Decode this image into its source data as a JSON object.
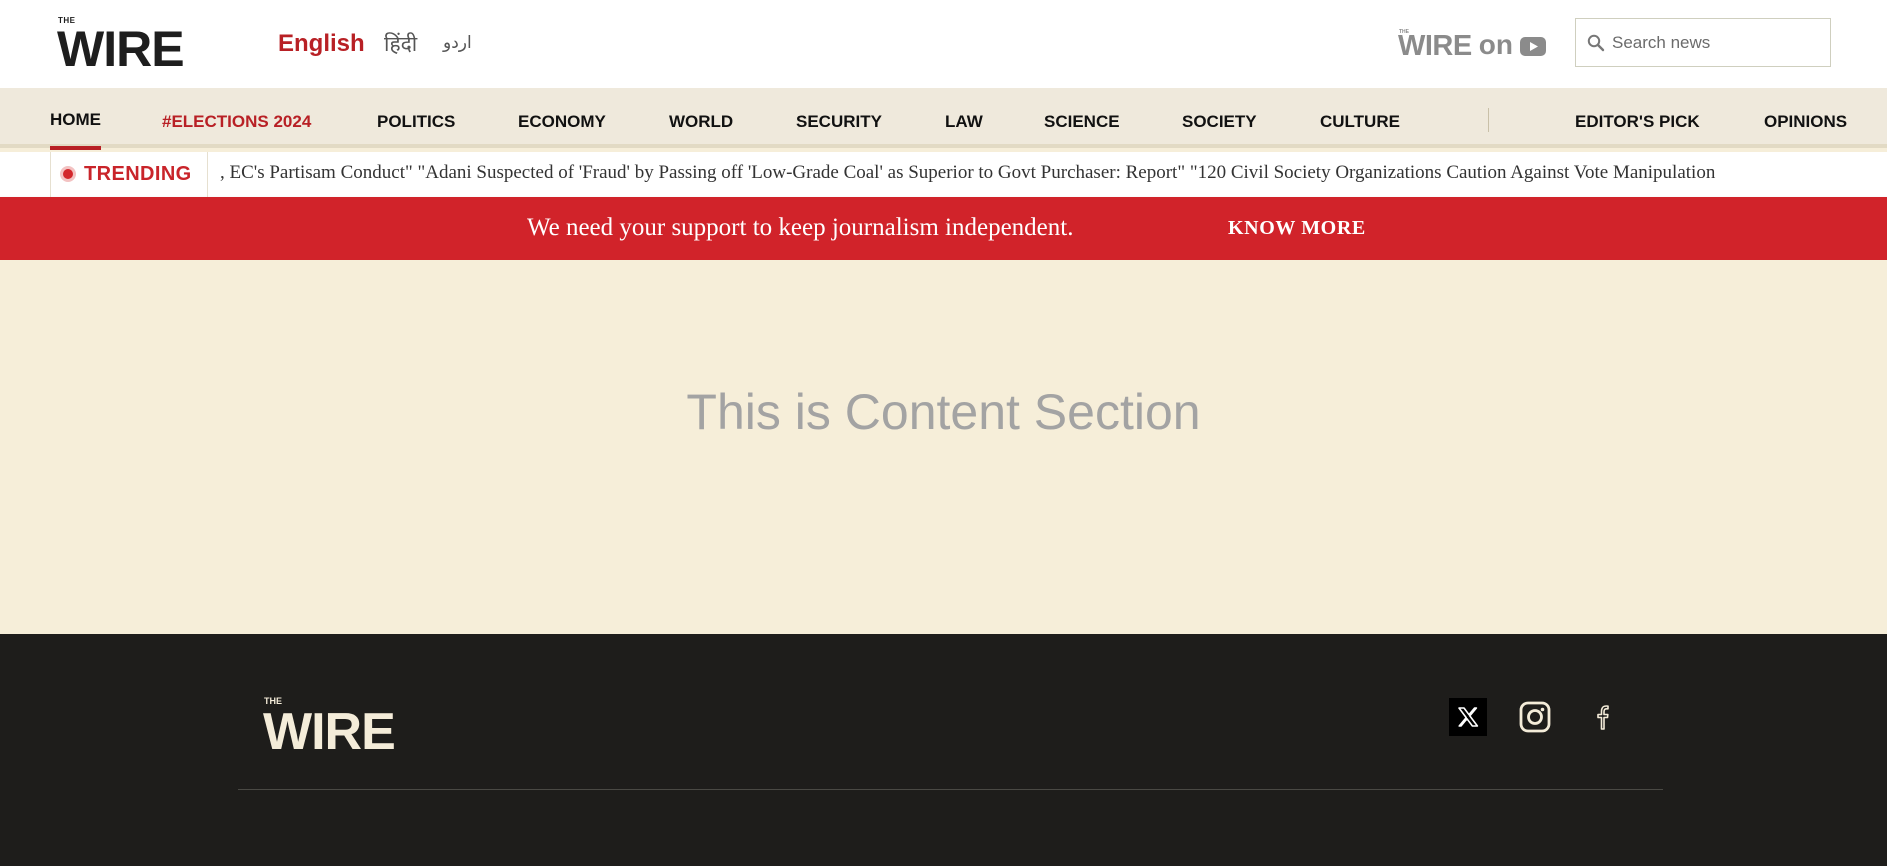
{
  "header": {
    "logo": {
      "small": "THE",
      "main": "WIRE"
    },
    "languages": [
      "English",
      "हिंदी",
      "اردو"
    ],
    "active_language": "English",
    "youtube_promo": {
      "small": "THE",
      "main": "WIRE",
      "on": "on",
      "icon": "youtube-icon"
    },
    "search": {
      "placeholder": "Search news",
      "icon": "search-icon"
    }
  },
  "nav": {
    "items": [
      {
        "label": "HOME",
        "active": true
      },
      {
        "label": "#ELECTIONS 2024",
        "highlight": true
      },
      {
        "label": "POLITICS"
      },
      {
        "label": "ECONOMY"
      },
      {
        "label": "WORLD"
      },
      {
        "label": "SECURITY"
      },
      {
        "label": "LAW"
      },
      {
        "label": "SCIENCE"
      },
      {
        "label": "SOCIETY"
      },
      {
        "label": "CULTURE"
      },
      {
        "label": "EDITOR'S PICK"
      },
      {
        "label": "OPINIONS"
      }
    ]
  },
  "trending": {
    "label": "TRENDING",
    "ticker": ", EC's Partisam Conduct\" \"Adani Suspected of 'Fraud' by Passing off 'Low-Grade Coal' as Superior to Govt Purchaser: Report\" \"120 Civil Society Organizations Caution Against Vote Manipulation"
  },
  "support_banner": {
    "text": "We need your support to keep journalism independent.",
    "button": "KNOW MORE"
  },
  "content": {
    "placeholder": "This is Content Section"
  },
  "footer": {
    "logo": {
      "small": "THE",
      "main": "WIRE"
    },
    "social": [
      "x-icon",
      "instagram-icon",
      "facebook-icon"
    ]
  },
  "colors": {
    "brand_red": "#d1232a",
    "nav_red": "#b82025",
    "header_bg": "#ffffff",
    "nav_bg": "#efe9dc",
    "content_bg": "#f6eed9",
    "footer_bg": "#1e1d1b",
    "footer_logo": "#f4ecd9"
  }
}
